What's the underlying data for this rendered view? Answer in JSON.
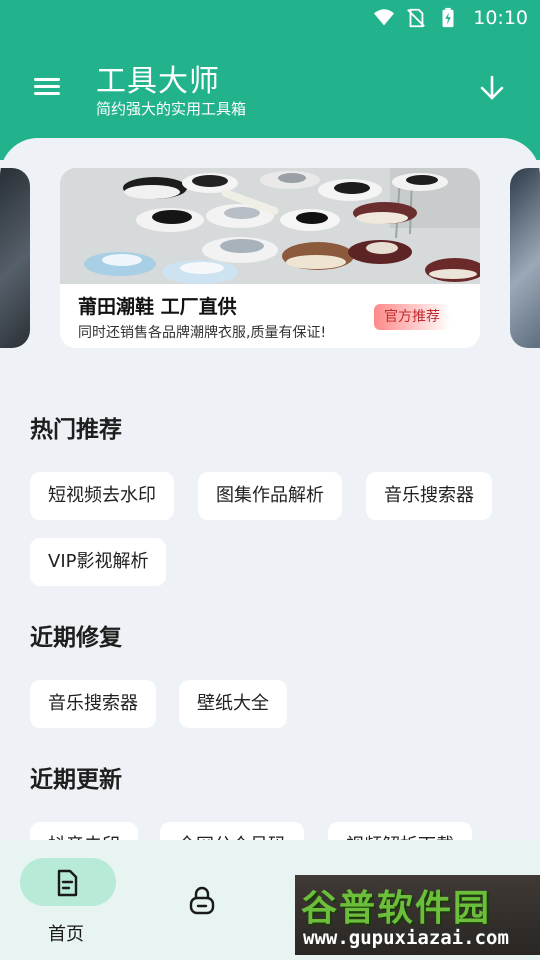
{
  "status_bar": {
    "time": "10:10",
    "icons": [
      "wifi-icon",
      "no-sim-icon",
      "battery-charging-icon"
    ]
  },
  "header": {
    "title": "工具大师",
    "subtitle": "简约强大的实用工具箱",
    "menu_icon": "menu-icon",
    "download_icon": "download-arrow-icon",
    "color": "#22b38d"
  },
  "banner": {
    "title": "莆田潮鞋  工厂直供",
    "description": "同时还销售各品牌潮牌衣服,质量有保证!",
    "badge": "官方推荐"
  },
  "sections": {
    "hot": {
      "title": "热门推荐",
      "items": [
        "短视频去水印",
        "图集作品解析",
        "音乐搜索器",
        "VIP影视解析"
      ]
    },
    "fixed": {
      "title": "近期修复",
      "items": [
        "音乐搜索器",
        "壁纸大全"
      ]
    },
    "updated": {
      "title": "近期更新",
      "items": [
        "抖音去印",
        "全网公众号码",
        "视频解析下载"
      ]
    }
  },
  "bottom_nav": {
    "home_label": "首页",
    "active_color": "#b8ead8"
  },
  "watermark": {
    "brand": "谷普软件园",
    "url": "www.gupuxiazai.com"
  }
}
